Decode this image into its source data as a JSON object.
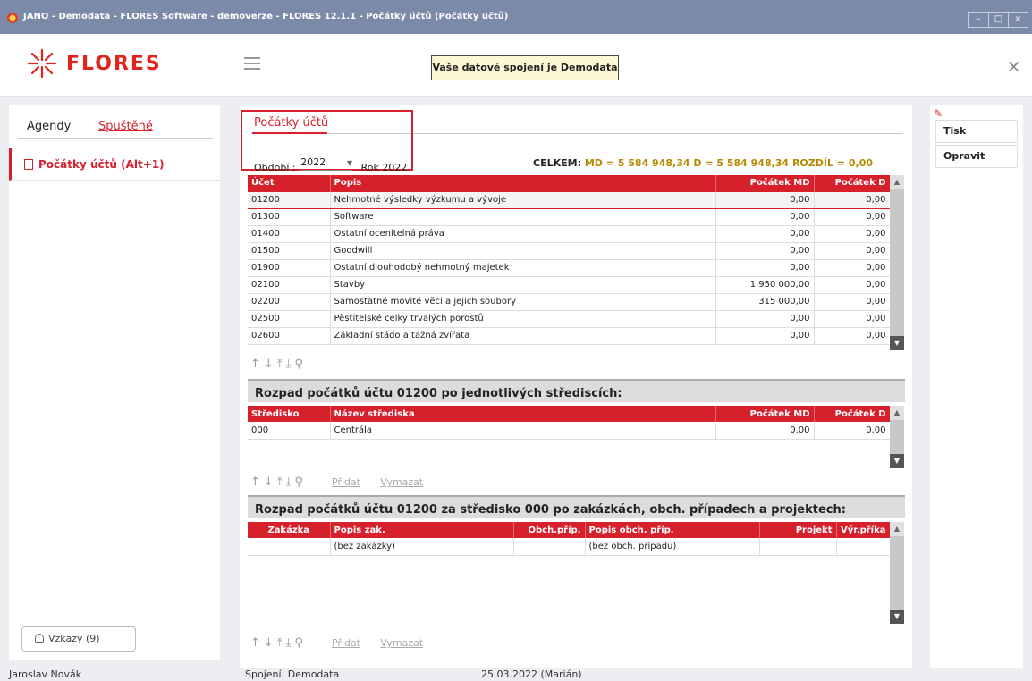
{
  "window": {
    "title": "JANO - Demodata - FLORES Software - demoverze - FLORES 12.1.1 - Počátky účtů  (Počátky účtů)",
    "controls": [
      "–",
      "□",
      "×"
    ]
  },
  "header": {
    "brand": "FLORES",
    "connection_notice": "Vaše datové spojení je Demodata",
    "close": "×"
  },
  "sidebar": {
    "tabs": [
      "Agendy",
      "Spuštěné"
    ],
    "items": [
      {
        "label": "Počátky účtů (Alt+1)"
      }
    ],
    "messages_label": "Vzkazy (9)"
  },
  "document": {
    "title": "Počátky účtů",
    "period_label": "Období :",
    "period_value": "2022",
    "period_year": "Rok 2022",
    "totals": {
      "celkem": "CELKEM:",
      "md": "MD =  5 584 948,34",
      "d": "D =  5 584 948,34",
      "rozdil_label": "ROZDÍL =",
      "rozdil_value": "0,00"
    }
  },
  "accounts_grid": {
    "columns": [
      "Účet",
      "Popis",
      "Počátek MD",
      "Počátek D"
    ],
    "rows": [
      [
        "01200",
        "Nehmotné výsledky výzkumu a vývoje",
        "0,00",
        "0,00"
      ],
      [
        "01300",
        "Software",
        "0,00",
        "0,00"
      ],
      [
        "01400",
        "Ostatní ocenitelná práva",
        "0,00",
        "0,00"
      ],
      [
        "01500",
        "Goodwill",
        "0,00",
        "0,00"
      ],
      [
        "01900",
        "Ostatní dlouhodobý nehmotný majetek",
        "0,00",
        "0,00"
      ],
      [
        "02100",
        "Stavby",
        "1 950 000,00",
        "0,00"
      ],
      [
        "02200",
        "Samostatné movité věci a jejich soubory",
        "315 000,00",
        "0,00"
      ],
      [
        "02500",
        "Pěstitelské celky trvalých porostů",
        "0,00",
        "0,00"
      ],
      [
        "02600",
        "Základní stádo a tažná zvířata",
        "0,00",
        "0,00"
      ]
    ]
  },
  "nav_icons": [
    "↑",
    "↓",
    "⤒",
    "⤓",
    "⚲"
  ],
  "centers_section": {
    "title": "Rozpad počátků účtu 01200 po jednotlivých střediscích:",
    "columns": [
      "Středisko",
      "Název střediska",
      "Počátek MD",
      "Počátek D"
    ],
    "rows": [
      [
        "000",
        "Centrála",
        "0,00",
        "0,00"
      ]
    ],
    "add_label": "Přidat",
    "delete_label": "Vymazat"
  },
  "orders_section": {
    "title": "Rozpad počátků účtu 01200 za středisko 000 po zakázkách, obch. případech a projektech:",
    "columns": [
      "Zakázka",
      "Popis zak.",
      "Obch.příp.",
      "Popis obch. příp.",
      "Projekt",
      "Výr.příka"
    ],
    "rows": [
      [
        "",
        "(bez zakázky)",
        "",
        "(bez obch. případu)",
        "",
        ""
      ]
    ],
    "add_label": "Přidat",
    "delete_label": "Vymazat"
  },
  "actions": {
    "print": "Tisk",
    "edit": "Opravit"
  },
  "status": {
    "user": "Jaroslav Novák",
    "connection": "Spojení: Demodata",
    "date": "25.03.2022 (Marián)"
  },
  "colors": {
    "accent": "#d6202c",
    "titlebar": "#7b8aa8",
    "totals_gold": "#b58a00",
    "notice_bg": "#fdf7d5"
  }
}
